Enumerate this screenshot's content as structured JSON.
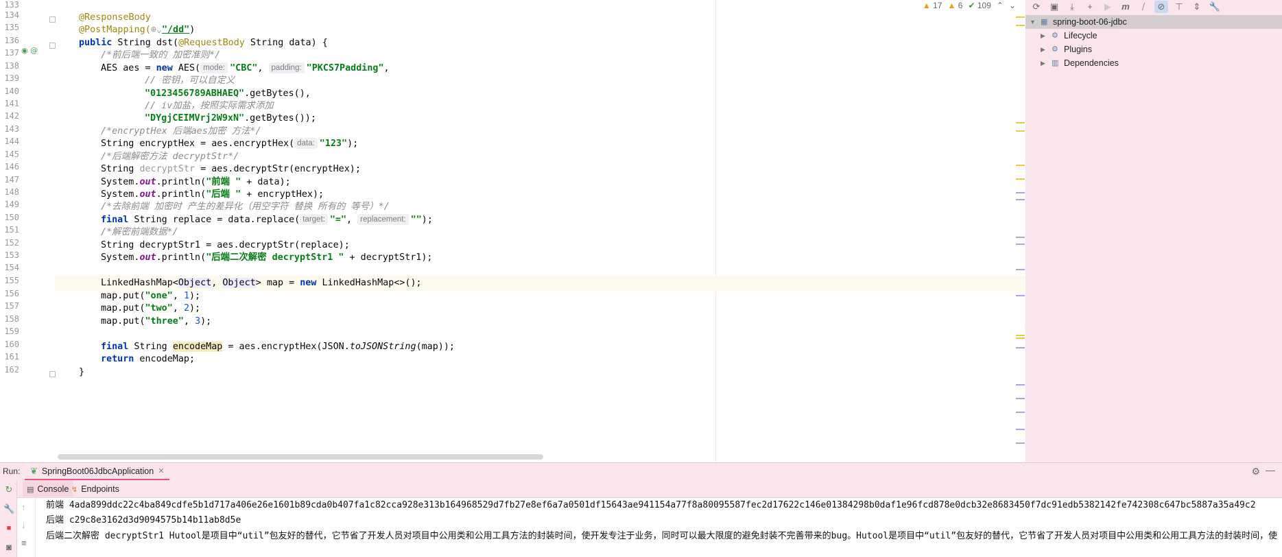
{
  "editor": {
    "line_numbers": [
      "133",
      "134",
      "135",
      "136",
      "137",
      "138",
      "139",
      "140",
      "141",
      "142",
      "143",
      "144",
      "145",
      "146",
      "147",
      "148",
      "149",
      "150",
      "151",
      "152",
      "153",
      "154",
      "155",
      "156",
      "157",
      "158",
      "159",
      "160",
      "161",
      "162"
    ],
    "inspections": {
      "warnings": "17",
      "weak_warnings": "6",
      "typos": "109"
    },
    "code": {
      "l134_ann": "@ResponseBody",
      "l135_ann": "@PostMapping(",
      "l135_path": "\"/dd\"",
      "l135_end": ")",
      "l136_kw": "public",
      "l136_a": " String dst(",
      "l136_ann": "@RequestBody",
      "l136_b": " String data) {",
      "l137": "/*前后端一致的 加密准则*/",
      "l138_a": "AES aes = ",
      "l138_new": "new",
      "l138_b": " AES(",
      "l138_hint1": "mode:",
      "l138_s1": "\"CBC\"",
      "l138_c": ", ",
      "l138_hint2": "padding:",
      "l138_s2": "\"PKCS7Padding\"",
      "l138_d": ",",
      "l139": "// 密钥，可以自定义",
      "l140_s": "\"0123456789ABHAEQ\"",
      "l140_b": ".getBytes(),",
      "l141": "// iv加盐，按照实际需求添加",
      "l142_s": "\"DYgjCEIMVrj2W9xN\"",
      "l142_b": ".getBytes());",
      "l143": "/*encryptHex 后端aes加密 方法*/",
      "l144_a": "String encryptHex = aes.encryptHex(",
      "l144_hint": "data:",
      "l144_s": "\"123\"",
      "l144_b": ");",
      "l145": "/*后端解密方法 decryptStr*/",
      "l146_a": "String ",
      "l146_u": "decryptStr",
      "l146_b": " = aes.decryptStr(encryptHex);",
      "l147_a": "System.",
      "l147_f": "out",
      "l147_b": ".println(",
      "l147_s": "\"前端 \"",
      "l147_c": " + data);",
      "l148_a": "System.",
      "l148_f": "out",
      "l148_b": ".println(",
      "l148_s": "\"后端 \"",
      "l148_c": " + encryptHex);",
      "l149": "/*去除前端 加密时 产生的差异化（用空字符 替换 所有的 等号）*/",
      "l150_kw": "final",
      "l150_a": " String replace = data.replace(",
      "l150_hint1": "target:",
      "l150_s1": "\"=\"",
      "l150_b": ", ",
      "l150_hint2": "replacement:",
      "l150_s2": "\"\"",
      "l150_c": ");",
      "l151": "/*解密前端数据*/",
      "l152": "String decryptStr1 = aes.decryptStr(replace);",
      "l153_a": "System.",
      "l153_f": "out",
      "l153_b": ".println(",
      "l153_s": "\"后端二次解密 decryptStr1 \"",
      "l153_c": " + decryptStr1);",
      "l155_a": "LinkedHashMap<",
      "l155_o1": "Object",
      "l155_b": ", ",
      "l155_o2": "Object",
      "l155_c": "> map = ",
      "l155_new": "new",
      "l155_d": " LinkedHashMap<>();",
      "l156_a": "map.put(",
      "l156_s": "\"one\"",
      "l156_b": ", ",
      "l156_n": "1",
      "l156_c": ");",
      "l157_a": "map.put(",
      "l157_s": "\"two\"",
      "l157_b": ", ",
      "l157_n": "2",
      "l157_c": ");",
      "l158_a": "map.put(",
      "l158_s": "\"three\"",
      "l158_b": ", ",
      "l158_n": "3",
      "l158_c": ");",
      "l160_kw": "final",
      "l160_a": " String ",
      "l160_v": "encodeMap",
      "l160_b": " = aes.encryptHex(JSON.",
      "l160_i": "toJSONString",
      "l160_c": "(map));",
      "l161_kw": "return",
      "l161_a": " encodeMap;",
      "l162": "}"
    }
  },
  "maven": {
    "project": "spring-boot-06-jdbc",
    "items": [
      "Lifecycle",
      "Plugins",
      "Dependencies"
    ]
  },
  "run": {
    "label": "Run:",
    "config_name": "SpringBoot06JdbcApplication",
    "tabs": [
      "Console",
      "Endpoints"
    ],
    "output": [
      "前端 4ada899ddc22c4ba849cdfe5b1d717a406e26e1601b89cda0b407fa1c82cca928e313b164968529d7fb27e8ef6a7a0501df15643ae941154a77f8a80095587fec2d17622c146e01384298b0daf1e96fcd878e0dcb32e8683450f7dc91edb5382142fe742308c647bc5887a35a49c2",
      "后端 c29c8e3162d3d9094575b14b11ab8d5e",
      "后端二次解密 decryptStr1 Hutool是项目中“util”包友好的替代，它节省了开发人员对项目中公用类和公用工具方法的封装时间，使开发专注于业务，同时可以最大限度的避免封装不完善带来的bug。Hutool是项目中“util”包友好的替代，它节省了开发人员对项目中公用类和公用工具方法的封装时间，使"
    ]
  },
  "colors": {
    "maven_bg": "#fbe5ec",
    "keyword": "#0033b3",
    "string": "#067d17",
    "annotation": "#9e880d",
    "comment": "#8c8c8c"
  }
}
